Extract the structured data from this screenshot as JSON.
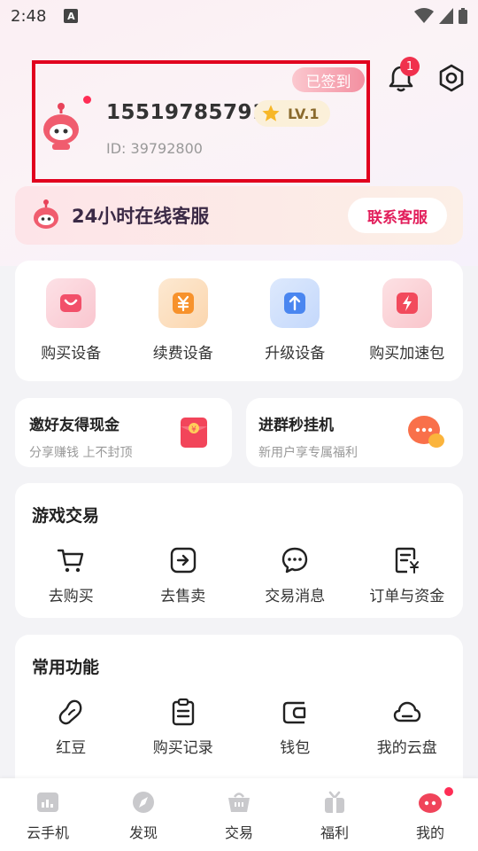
{
  "status_bar": {
    "time": "2:48",
    "indicator": "A"
  },
  "profile": {
    "signed_badge": "已签到",
    "phone": "15519785791",
    "level": "LV.1",
    "user_id": "ID: 39792800",
    "notification_count": "1"
  },
  "service": {
    "title": "24小时在线客服",
    "button": "联系客服"
  },
  "device_actions": [
    {
      "label": "购买设备",
      "icon": "shopping-bag-icon"
    },
    {
      "label": "续费设备",
      "icon": "yen-icon"
    },
    {
      "label": "升级设备",
      "icon": "upload-arrow-icon"
    },
    {
      "label": "购买加速包",
      "icon": "lightning-icon"
    }
  ],
  "promos": [
    {
      "title": "邀好友得现金",
      "subtitle": "分享赚钱 上不封顶",
      "icon": "red-envelope-icon"
    },
    {
      "title": "进群秒挂机",
      "subtitle": "新用户享专属福利",
      "icon": "chat-bubble-icon"
    }
  ],
  "game_trade": {
    "title": "游戏交易",
    "items": [
      {
        "label": "去购买",
        "icon": "cart-icon"
      },
      {
        "label": "去售卖",
        "icon": "sell-arrow-icon"
      },
      {
        "label": "交易消息",
        "icon": "message-icon"
      },
      {
        "label": "订单与资金",
        "icon": "order-icon"
      }
    ]
  },
  "common_functions": {
    "title": "常用功能",
    "items": [
      {
        "label": "红豆",
        "icon": "bean-icon"
      },
      {
        "label": "购买记录",
        "icon": "clipboard-icon"
      },
      {
        "label": "钱包",
        "icon": "wallet-icon"
      },
      {
        "label": "我的云盘",
        "icon": "cloud-icon"
      }
    ]
  },
  "bottom_nav": [
    {
      "label": "云手机",
      "icon": "cloud-phone-icon"
    },
    {
      "label": "发现",
      "icon": "compass-icon"
    },
    {
      "label": "交易",
      "icon": "basket-icon"
    },
    {
      "label": "福利",
      "icon": "gift-icon"
    },
    {
      "label": "我的",
      "icon": "profile-mascot-icon"
    }
  ],
  "colors": {
    "accent": "#e21e5b",
    "highlight_border": "#e1001e",
    "badge": "#f0304d"
  }
}
